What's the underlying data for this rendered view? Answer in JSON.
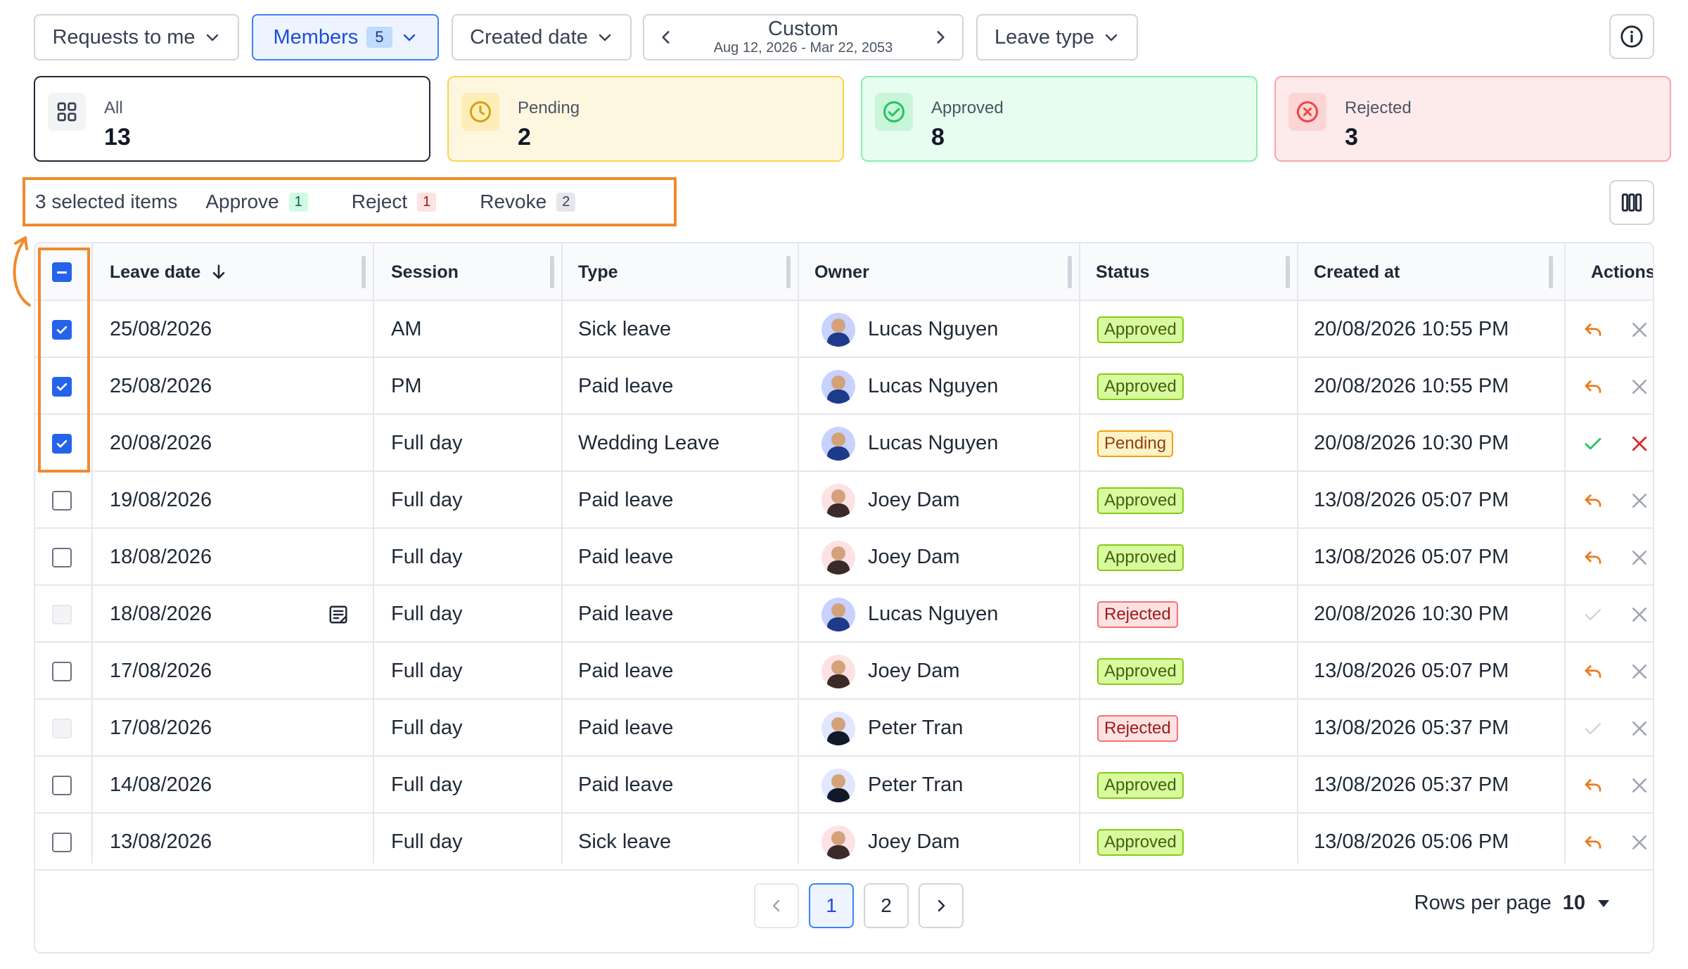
{
  "toolbar": {
    "requests_label": "Requests to me",
    "members_label": "Members",
    "members_count": "5",
    "created_date_label": "Created date",
    "date_title": "Custom",
    "date_range": "Aug 12, 2026 - Mar 22, 2053",
    "leave_type_label": "Leave type"
  },
  "summary": [
    {
      "label": "All",
      "value": "13"
    },
    {
      "label": "Pending",
      "value": "2"
    },
    {
      "label": "Approved",
      "value": "8"
    },
    {
      "label": "Rejected",
      "value": "3"
    }
  ],
  "bulk": {
    "selected_text": "3 selected items",
    "approve_label": "Approve",
    "approve_count": "1",
    "reject_label": "Reject",
    "reject_count": "1",
    "revoke_label": "Revoke",
    "revoke_count": "2"
  },
  "table": {
    "headers": [
      "Leave date",
      "Session",
      "Type",
      "Owner",
      "Status",
      "Created at",
      "Actions"
    ],
    "rows": [
      {
        "date": "25/08/2026",
        "session": "AM",
        "type": "Sick leave",
        "owner": "Lucas Nguyen",
        "status": "Approved",
        "created": "20/08/2026 10:55 PM",
        "checkbox": "checked",
        "avatar": "lucas",
        "actions": "revoke"
      },
      {
        "date": "25/08/2026",
        "session": "PM",
        "type": "Paid leave",
        "owner": "Lucas Nguyen",
        "status": "Approved",
        "created": "20/08/2026 10:55 PM",
        "checkbox": "checked",
        "avatar": "lucas",
        "actions": "revoke"
      },
      {
        "date": "20/08/2026",
        "session": "Full day",
        "type": "Wedding Leave",
        "owner": "Lucas Nguyen",
        "status": "Pending",
        "created": "20/08/2026 10:30 PM",
        "checkbox": "checked",
        "avatar": "lucas",
        "actions": "pending"
      },
      {
        "date": "19/08/2026",
        "session": "Full day",
        "type": "Paid leave",
        "owner": "Joey Dam",
        "status": "Approved",
        "created": "13/08/2026 05:07 PM",
        "checkbox": "unchecked",
        "avatar": "joey",
        "actions": "revoke"
      },
      {
        "date": "18/08/2026",
        "session": "Full day",
        "type": "Paid leave",
        "owner": "Joey Dam",
        "status": "Approved",
        "created": "13/08/2026 05:07 PM",
        "checkbox": "unchecked",
        "avatar": "joey",
        "actions": "revoke"
      },
      {
        "date": "18/08/2026",
        "session": "Full day",
        "type": "Paid leave",
        "owner": "Lucas Nguyen",
        "status": "Rejected",
        "created": "20/08/2026 10:30 PM",
        "checkbox": "disabled",
        "avatar": "lucas",
        "actions": "disabled",
        "note": true
      },
      {
        "date": "17/08/2026",
        "session": "Full day",
        "type": "Paid leave",
        "owner": "Joey Dam",
        "status": "Approved",
        "created": "13/08/2026 05:07 PM",
        "checkbox": "unchecked",
        "avatar": "joey",
        "actions": "revoke"
      },
      {
        "date": "17/08/2026",
        "session": "Full day",
        "type": "Paid leave",
        "owner": "Peter Tran",
        "status": "Rejected",
        "created": "13/08/2026 05:37 PM",
        "checkbox": "disabled",
        "avatar": "peter",
        "actions": "disabled"
      },
      {
        "date": "14/08/2026",
        "session": "Full day",
        "type": "Paid leave",
        "owner": "Peter Tran",
        "status": "Approved",
        "created": "13/08/2026 05:37 PM",
        "checkbox": "unchecked",
        "avatar": "peter",
        "actions": "revoke"
      },
      {
        "date": "13/08/2026",
        "session": "Full day",
        "type": "Sick leave",
        "owner": "Joey Dam",
        "status": "Approved",
        "created": "13/08/2026 05:06 PM",
        "checkbox": "unchecked",
        "avatar": "joey",
        "actions": "revoke"
      }
    ]
  },
  "pagination": {
    "pages": [
      "1",
      "2"
    ],
    "current": "1",
    "rows_per_page_label": "Rows per page",
    "rows_per_page_value": "10"
  },
  "colors": {
    "accent": "#2563eb",
    "highlight": "#f08a2c",
    "approved": "#84cc16",
    "pending": "#f59e0b",
    "rejected": "#f87171"
  }
}
